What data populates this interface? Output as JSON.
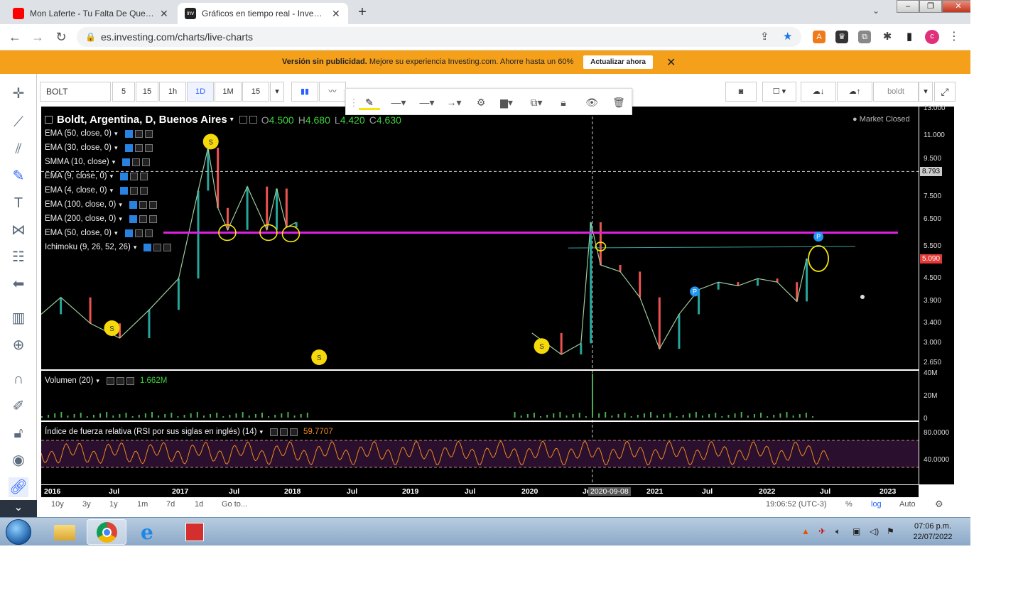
{
  "browser": {
    "tabs": [
      {
        "title": "Mon Laferte - Tu Falta De Querer",
        "active": false
      },
      {
        "title": "Gráficos en tiempo real - Investing",
        "active": true
      }
    ],
    "url": "es.investing.com/charts/live-charts",
    "profile_initial": "c"
  },
  "promo": {
    "bold": "Versión sin publicidad.",
    "text": " Mejore su experiencia Investing.com. Ahorre hasta un 60%",
    "button": "Actualizar ahora"
  },
  "toolbar": {
    "symbol": "BOLT",
    "intervals": [
      "5",
      "15",
      "1h",
      "1D",
      "1M",
      "15"
    ],
    "active_interval": "1D",
    "layout_name": "boldt"
  },
  "legend": {
    "title": "Boldt, Argentina, D, Buenos Aires",
    "ohlc": [
      {
        "k": "O",
        "v": "4.500"
      },
      {
        "k": "H",
        "v": "4.680"
      },
      {
        "k": "L",
        "v": "4.420"
      },
      {
        "k": "C",
        "v": "4.630"
      }
    ],
    "market_status": "Market Closed",
    "indicators": [
      "EMA (50, close, 0)",
      "EMA (30, close, 0)",
      "SMMA (10, close)",
      "EMA (9, close, 0)",
      "EMA (4, close, 0)",
      "EMA (100, close, 0)",
      "EMA (200, close, 0)",
      "EMA (50, close, 0)",
      "Ichimoku (9, 26, 52, 26)"
    ],
    "volume_label": "Volumen (20)",
    "volume_value": "1.662M",
    "rsi_label": "Índice de fuerza relativa (RSI por sus siglas en inglés) (14)",
    "rsi_value": "59.7707"
  },
  "chart_data": {
    "type": "line",
    "price_ticks": [
      "13.000",
      "11.000",
      "9.500",
      "8.793",
      "7.500",
      "6.500",
      "5.500",
      "5.090",
      "4.500",
      "3.900",
      "3.400",
      "3.000",
      "2.650"
    ],
    "crosshair_price": "8.793",
    "last_price": "5.090",
    "volume_ticks": [
      "40M",
      "20M",
      "0"
    ],
    "rsi_ticks": [
      "80.0000",
      "40.0000"
    ],
    "x_ticks": [
      "2016",
      "Jul",
      "2017",
      "Jul",
      "2018",
      "Jul",
      "2019",
      "Jul",
      "2020",
      "Jul",
      "2021",
      "Jul",
      "2022",
      "Jul",
      "2023"
    ],
    "crosshair_date": "2020-09-08",
    "resistance_level": 6.0,
    "marker_s": "S",
    "marker_p": "P",
    "colors": {
      "up": "#26a69a",
      "down": "#ef5350",
      "resistance": "#e020e0",
      "rsi": "#f08a1c",
      "annotation": "#f5e60a"
    },
    "series": [
      {
        "x": "2016-01",
        "y": 3.6
      },
      {
        "x": "2016-03",
        "y": 4.0
      },
      {
        "x": "2016-06",
        "y": 3.4
      },
      {
        "x": "2016-09",
        "y": 3.1
      },
      {
        "x": "2016-12",
        "y": 3.7
      },
      {
        "x": "2017-03",
        "y": 4.5
      },
      {
        "x": "2017-05",
        "y": 7.8
      },
      {
        "x": "2017-06",
        "y": 10.2
      },
      {
        "x": "2017-07",
        "y": 7.0
      },
      {
        "x": "2017-08",
        "y": 6.1
      },
      {
        "x": "2017-10",
        "y": 8.0
      },
      {
        "x": "2017-12",
        "y": 6.1
      },
      {
        "x": "2018-01",
        "y": 7.9
      },
      {
        "x": "2018-02",
        "y": 6.2
      },
      {
        "x": "2018-03",
        "y": 6.4
      },
      {
        "x": "2020-03",
        "y": 3.2
      },
      {
        "x": "2020-06",
        "y": 2.8
      },
      {
        "x": "2020-08",
        "y": 3.0
      },
      {
        "x": "2020-09",
        "y": 6.4
      },
      {
        "x": "2020-10",
        "y": 4.9
      },
      {
        "x": "2020-12",
        "y": 4.7
      },
      {
        "x": "2021-02",
        "y": 4.0
      },
      {
        "x": "2021-04",
        "y": 2.9
      },
      {
        "x": "2021-06",
        "y": 3.6
      },
      {
        "x": "2021-08",
        "y": 4.2
      },
      {
        "x": "2021-10",
        "y": 4.4
      },
      {
        "x": "2021-12",
        "y": 4.3
      },
      {
        "x": "2022-02",
        "y": 4.5
      },
      {
        "x": "2022-04",
        "y": 4.4
      },
      {
        "x": "2022-06",
        "y": 3.9
      },
      {
        "x": "2022-07",
        "y": 5.1
      }
    ]
  },
  "range_bar": {
    "ranges": [
      "10y",
      "3y",
      "1y",
      "1m",
      "7d",
      "1d"
    ],
    "goto": "Go to...",
    "time": "19:06:52 (UTC-3)",
    "percent": "%",
    "log": "log",
    "auto": "Auto"
  },
  "taskbar": {
    "time": "07:06 p.m.",
    "date": "22/07/2022"
  }
}
